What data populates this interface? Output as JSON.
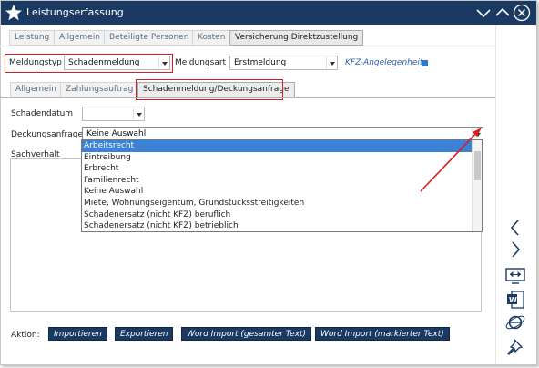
{
  "window": {
    "title": "Leistungserfassung",
    "controls": [
      "chevron-down-icon",
      "chevron-up-icon",
      "close-icon"
    ]
  },
  "tabs_top": [
    "Leistung",
    "Allgemein",
    "Beteiligte Personen",
    "Kosten",
    "Versicherung Direktzustellung"
  ],
  "tabs_top_active": "Versicherung Direktzustellung",
  "form": {
    "meldungstyp_label": "Meldungstyp",
    "meldungstyp_value": "Schadenmeldung",
    "meldungsart_label": "Meldungsart",
    "meldungsart_value": "Erstmeldung",
    "kfz_link": "KFZ-Angelegenheit"
  },
  "tabs_sub": [
    "Allgemein",
    "Zahlungsauftrag",
    "Schadenmeldung/Deckungsanfrage"
  ],
  "tabs_sub_active": "Schadenmeldung/Deckungsanfrage",
  "schaden": {
    "schadendatum_label": "Schadendatum",
    "schadendatum_value": "",
    "deckungsanfrage_label": "Deckungsanfrage",
    "deckungsanfrage_value": "Keine Auswahl",
    "sachverhalt_label": "Sachverhalt",
    "options": [
      "Arbeitsrecht",
      "Eintreibung",
      "Erbrecht",
      "Familienrecht",
      "Keine Auswahl",
      "Miete, Wohnungseigentum, Grundstücksstreitigkeiten",
      "Schadenersatz (nicht KFZ) beruflich",
      "Schadenersatz (nicht KFZ) betrieblich"
    ],
    "selected_option": "Arbeitsrecht"
  },
  "actions": {
    "label": "Aktion:",
    "buttons": [
      "Importieren",
      "Exportieren",
      "Word Import (gesamter Text)",
      "Word Import (markierter Text)"
    ]
  },
  "sidebar_icons": [
    "chevron-left-icon",
    "chevron-right-icon",
    "split-screen-icon",
    "word-icon",
    "internet-explorer-icon",
    "pin-icon"
  ],
  "colors": {
    "titlebar": "#1b3a63",
    "button": "#1b3a63",
    "selection": "#3b82d6",
    "highlight_box": "#d41e1e",
    "link": "#2f5da8"
  }
}
